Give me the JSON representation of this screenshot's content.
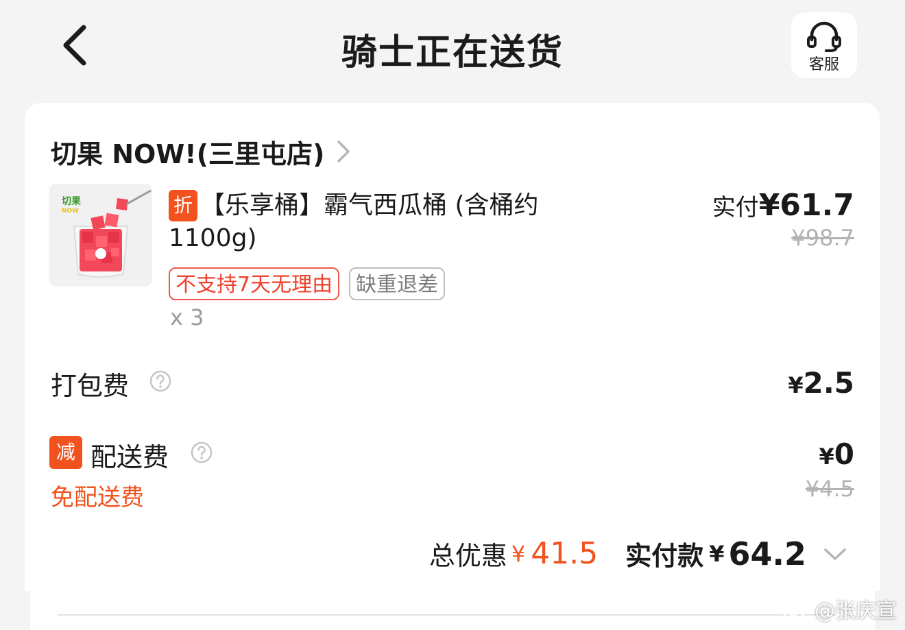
{
  "header": {
    "title": "骑士正在送货",
    "customer_service_label": "客服"
  },
  "store": {
    "name": "切果 NOW!(三里屯店)"
  },
  "product": {
    "discount_badge": "折",
    "title": "【乐享桶】霸气西瓜桶 (含桶约1100g)",
    "tags": [
      "不支持7天无理由",
      "缺重退差"
    ],
    "quantity": "x 3",
    "paid_label": "实付",
    "paid_price": "¥61.7",
    "original_price": "¥98.7",
    "image_brand_text": "切果",
    "image_brand_sub": "NOW"
  },
  "packaging_fee": {
    "label": "打包费",
    "value": "2.5",
    "currency": "¥"
  },
  "delivery_fee": {
    "badge": "减",
    "label": "配送费",
    "value": "0",
    "currency": "¥",
    "original": "¥4.5",
    "promo_text": "免配送费"
  },
  "summary": {
    "discount_label": "总优惠",
    "discount_currency": "¥",
    "discount_value": "41.5",
    "pay_label": "实付款",
    "pay_currency": "¥",
    "pay_value": "64.2"
  },
  "watermark": {
    "text": "@张庆宣"
  },
  "colors": {
    "accent": "#f2521d",
    "tag_red": "#f0402c",
    "background": "#f4f4f4",
    "card": "#ffffff"
  }
}
